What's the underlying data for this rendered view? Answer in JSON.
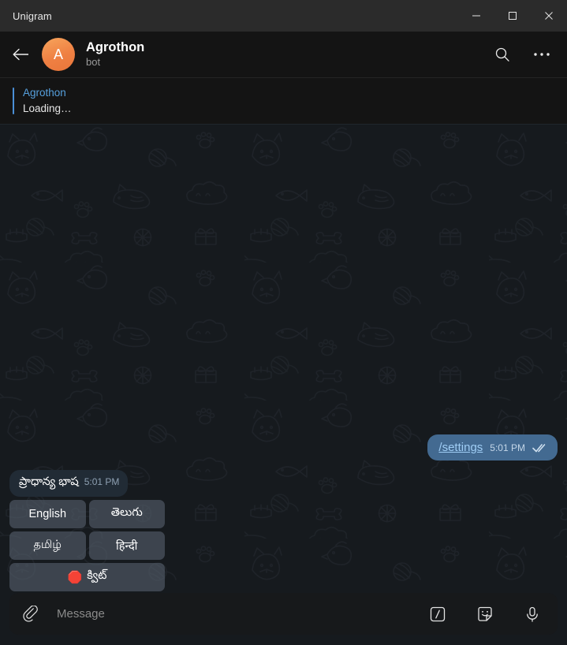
{
  "window": {
    "title": "Unigram",
    "controls": [
      {
        "name": "minimize",
        "glyph": "—"
      },
      {
        "name": "maximize",
        "glyph": "☐"
      },
      {
        "name": "close",
        "glyph": "✕"
      }
    ]
  },
  "header": {
    "back_icon": "back-arrow-icon",
    "avatar_letter": "A",
    "avatar_color": "#ef8043",
    "title": "Agrothon",
    "subtitle": "bot",
    "search_icon": "search-icon",
    "more_icon": "more-options-icon"
  },
  "pinned": {
    "accent_color": "#4a8fd6",
    "author": "Agrothon",
    "text": "Loading…"
  },
  "messages": {
    "outgoing": {
      "text": "/settings",
      "time": "5:01 PM",
      "status_icon": "double-check-icon",
      "bubble_color": "#436a91",
      "link_color": "#9fcdf5"
    },
    "incoming": {
      "text": "ప్రాధాన్య భాష",
      "time": "5:01 PM",
      "bubble_color": "#212b35"
    }
  },
  "keyboard": {
    "rows": [
      [
        {
          "label": "English",
          "emoji": ""
        },
        {
          "label": "తెలుగు",
          "emoji": ""
        }
      ],
      [
        {
          "label": "தமிழ்",
          "emoji": ""
        },
        {
          "label": "हिन्दी",
          "emoji": ""
        }
      ],
      [
        {
          "label": "క్విట్",
          "emoji": "🛑"
        }
      ]
    ]
  },
  "composer": {
    "attach_icon": "paperclip-icon",
    "placeholder": "Message",
    "value": "",
    "commands_icon": "slash-commands-icon",
    "sticker_icon": "sticker-icon",
    "mic_icon": "microphone-icon"
  }
}
